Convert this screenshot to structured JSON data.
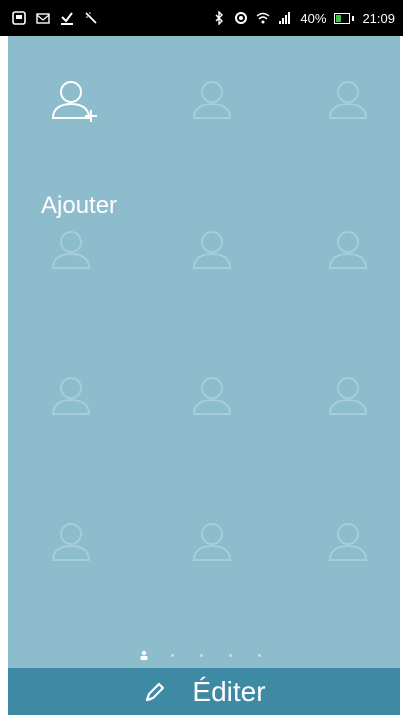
{
  "status_bar": {
    "left_icons": [
      "notification-icon",
      "mail-icon",
      "check-icon",
      "magic-wand-icon"
    ],
    "right_icons": [
      "bluetooth-icon",
      "sync-icon",
      "wifi-icon",
      "signal-icon"
    ],
    "battery_percent_label": "40%",
    "battery_level": 0.4,
    "time": "21:09"
  },
  "grid": {
    "add_label": "Ajouter",
    "placeholder_count": 11
  },
  "pager": {
    "pages": 5,
    "active_index": 0
  },
  "bottom_bar": {
    "edit_label": "Éditer",
    "icon": "pencil-icon"
  },
  "colors": {
    "content_bg": "#8dbccc",
    "bottom_bar_bg": "#3e8aa5",
    "status_bar_bg": "#000000",
    "battery_green": "#3ac34a"
  }
}
